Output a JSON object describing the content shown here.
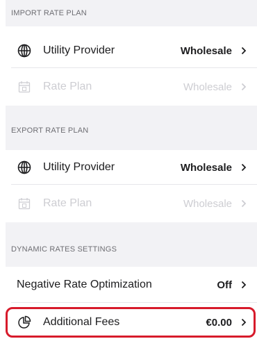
{
  "import_section": {
    "header": "IMPORT RATE PLAN",
    "utility_provider": {
      "label": "Utility Provider",
      "value": "Wholesale",
      "icon": "globe-icon"
    },
    "rate_plan": {
      "label": "Rate Plan",
      "value": "Wholesale",
      "icon": "calendar-icon",
      "disabled": true
    }
  },
  "export_section": {
    "header": "EXPORT RATE PLAN",
    "utility_provider": {
      "label": "Utility Provider",
      "value": "Wholesale",
      "icon": "globe-icon"
    },
    "rate_plan": {
      "label": "Rate Plan",
      "value": "Wholesale",
      "icon": "calendar-icon",
      "disabled": true
    }
  },
  "dynamic_section": {
    "header": "DYNAMIC RATES SETTINGS",
    "negative_rate": {
      "label": "Negative Rate Optimization",
      "value": "Off"
    },
    "additional_fees": {
      "label": "Additional Fees",
      "value": "€0.00",
      "icon": "pie-chart-icon"
    }
  },
  "colors": {
    "highlight": "#d71a2b",
    "section_background": "#f2f2f5",
    "disabled_text": "#cdcdd2"
  }
}
